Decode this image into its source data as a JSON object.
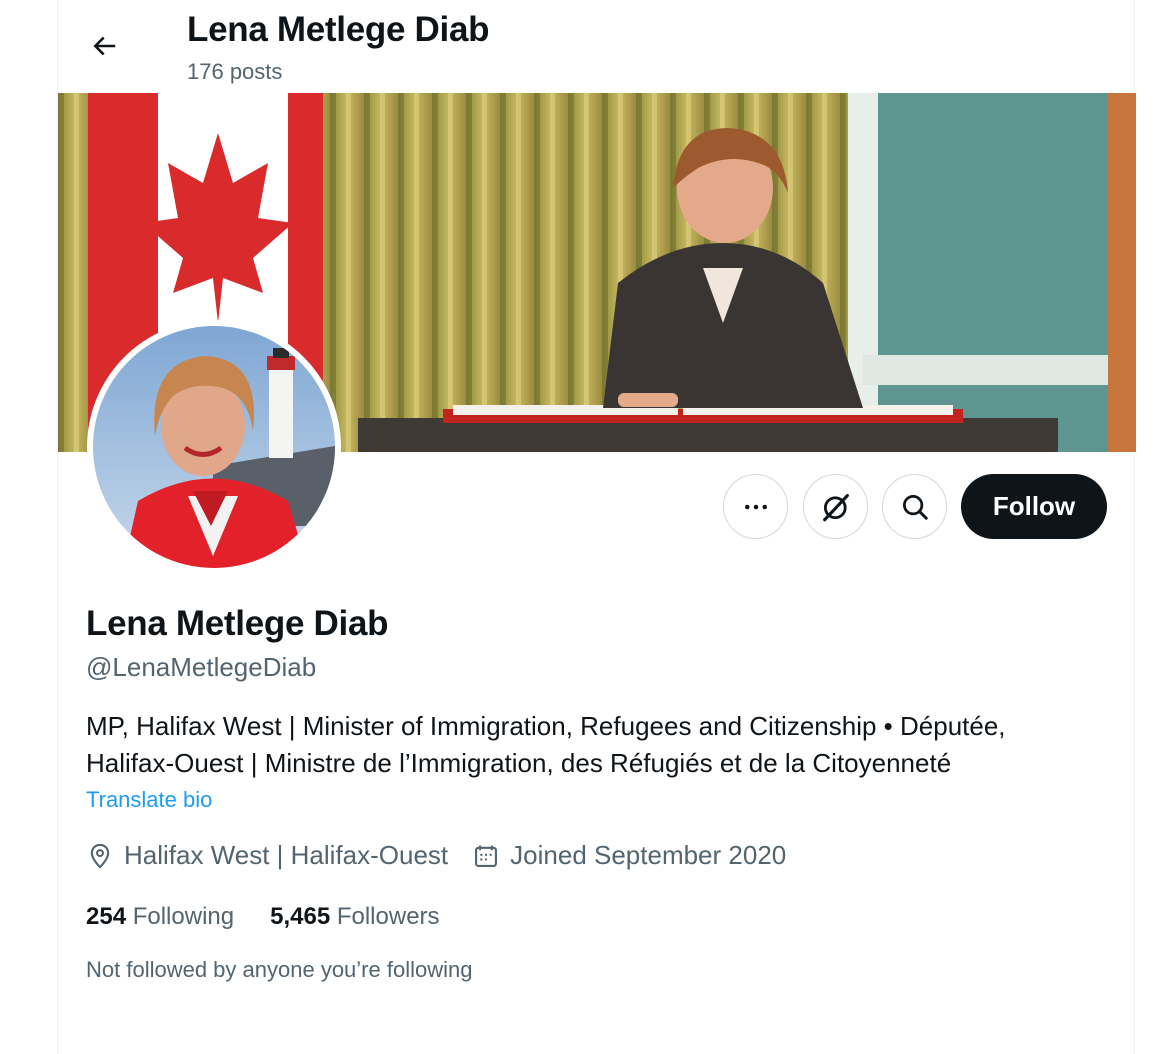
{
  "header": {
    "back_icon": "arrow-left-icon",
    "name": "Lena Metlege Diab",
    "posts": "176 posts"
  },
  "profile": {
    "display_name": "Lena Metlege Diab",
    "handle": "@LenaMetlegeDiab",
    "bio_line1": "MP, Halifax West | Minister of Immigration, Refugees and Citizenship • Députée,",
    "bio_line2": "Halifax-Ouest | Ministre de l’Immigration, des Réfugiés et de la Citoyenneté",
    "translate_label": "Translate bio",
    "location": "Halifax West | Halifax-Ouest",
    "joined": "Joined September 2020",
    "following_count": "254",
    "following_label": "Following",
    "followers_count": "5,465",
    "followers_label": "Followers",
    "not_followed": "Not followed by anyone you’re following"
  },
  "actions": {
    "more_icon": "more-horizontal-icon",
    "grok_icon": "grok-icon",
    "search_icon": "search-icon",
    "follow_label": "Follow"
  },
  "colors": {
    "accent": "#1d9bf0",
    "text_primary": "#0f1419",
    "text_secondary": "#536471",
    "follow_bg": "#0f1419"
  }
}
